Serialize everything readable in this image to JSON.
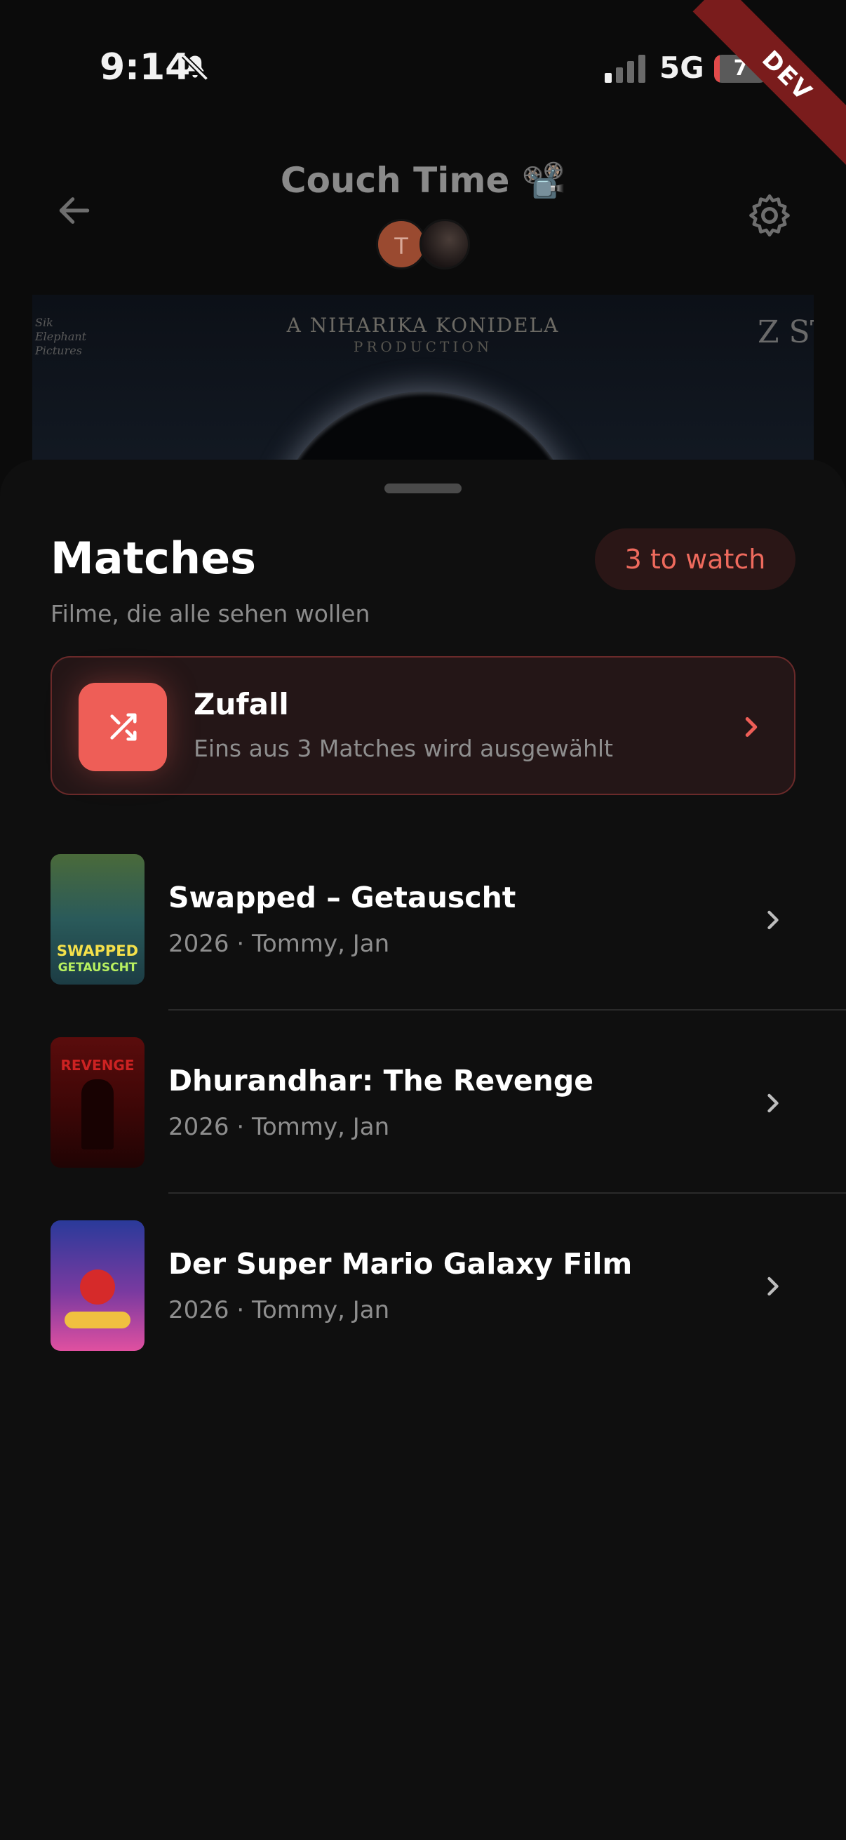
{
  "status_bar": {
    "time": "9:14",
    "network": "5G",
    "battery_level": "7",
    "battery_fraction": 0.07
  },
  "dev_ribbon": "DEV",
  "header": {
    "title": "Couch Time 📽️",
    "avatar_initial": "T"
  },
  "banner": {
    "credit_line": "A NIHARIKA KONIDELA",
    "credit_sub": "PRODUCTION",
    "left_logo": "Sik Elephant Pictures",
    "right_logo": "Z ST"
  },
  "sheet": {
    "title": "Matches",
    "subtitle": "Filme, die alle sehen wollen",
    "badge": "3 to watch",
    "random": {
      "title": "Zufall",
      "subtitle": "Eins aus 3 Matches wird ausgewählt"
    },
    "movies": [
      {
        "title": "Swapped – Getauscht",
        "meta": "2026 · Tommy, Jan",
        "poster_line1": "SWAPPED",
        "poster_line2": "GETAUSCHT"
      },
      {
        "title": "Dhurandhar: The Revenge",
        "meta": "2026 · Tommy, Jan",
        "poster_line1": "REVENGE",
        "poster_line2": ""
      },
      {
        "title": "Der Super Mario Galaxy Film",
        "meta": "2026 · Tommy, Jan",
        "poster_line1": "",
        "poster_line2": ""
      }
    ]
  },
  "colors": {
    "accent": "#ee5e57",
    "badge_bg": "#2a1616",
    "card_bg": "#241617",
    "sheet_bg": "#0f0f0f"
  }
}
